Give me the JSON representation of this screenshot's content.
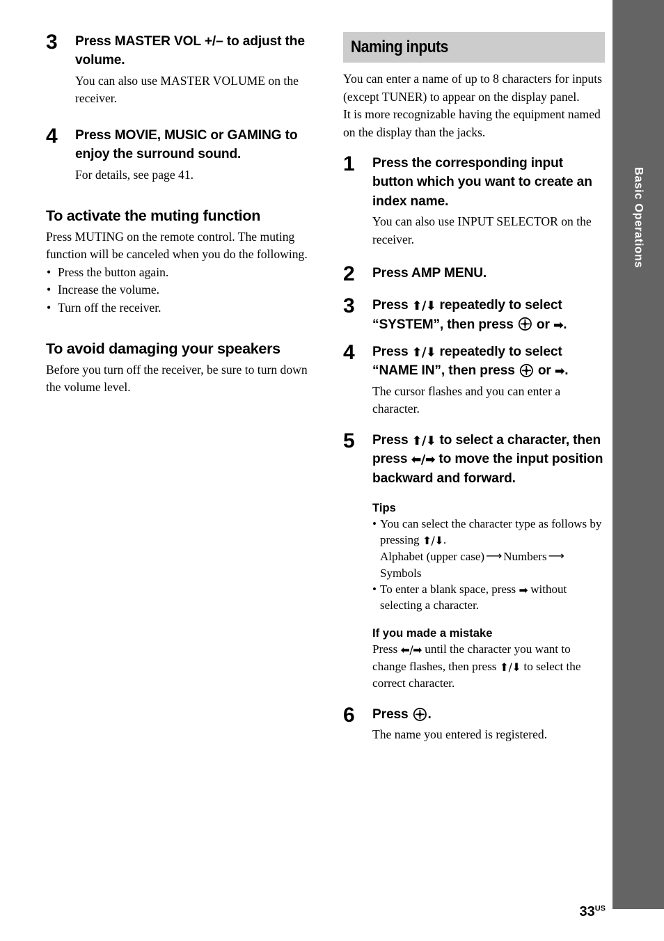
{
  "page": {
    "folio_number": "33",
    "folio_suffix": "US",
    "side_tab_label": "Basic Operations",
    "side_tab_color": "#646464",
    "banner_color": "#cccccc"
  },
  "glyphs": {
    "arrow_up": "⬆",
    "arrow_down": "⬇",
    "arrow_left": "⬅",
    "arrow_right": "➡",
    "arrow_updown": "⬆/⬇",
    "arrow_leftright": "⬅/➡",
    "long_arrow_right": "⟶",
    "enter_button": "enter-button-icon",
    "bullet": "•"
  },
  "left_column": {
    "steps": [
      {
        "number": "3",
        "title": "Press MASTER VOL +/– to adjust the volume.",
        "description": "You can also use MASTER VOLUME on the receiver."
      },
      {
        "number": "4",
        "title": "Press MOVIE, MUSIC or GAMING to enjoy the surround sound.",
        "description": "For details, see page 41."
      }
    ],
    "sections": [
      {
        "heading": "To activate the muting function",
        "paragraph": "Press MUTING on the remote control. The muting function will be canceled when you do the following.",
        "bullets": [
          "Press the button again.",
          "Increase the volume.",
          "Turn off the receiver."
        ]
      },
      {
        "heading": "To avoid damaging your speakers",
        "paragraph": "Before you turn off the receiver, be sure to turn down the volume level.",
        "bullets": []
      }
    ]
  },
  "right_column": {
    "banner_title": "Naming inputs",
    "intro_paragraph_1": "You can enter a name of up to 8 characters for inputs (except TUNER) to appear on the display panel.",
    "intro_paragraph_2": "It is more recognizable having the equipment named on the display than the jacks.",
    "steps": [
      {
        "number": "1",
        "title": "Press the corresponding input button which you want to create an index name.",
        "description": "You can also use INPUT SELECTOR on the receiver."
      },
      {
        "number": "2",
        "title": "Press AMP MENU.",
        "description": ""
      },
      {
        "number": "3",
        "title_part_1": "Press ",
        "title_part_2": " repeatedly to select “SYSTEM”, then press ",
        "title_part_3": " or ",
        "title_part_4": ".",
        "description": ""
      },
      {
        "number": "4",
        "title_part_1": "Press ",
        "title_part_2": " repeatedly to select “NAME IN”, then press ",
        "title_part_3": " or ",
        "title_part_4": ".",
        "description": "The cursor flashes and you can enter a character."
      },
      {
        "number": "5",
        "title_part_1": "Press ",
        "title_part_2": " to select a character, then press ",
        "title_part_3": " to move the input position backward and forward.",
        "description": ""
      },
      {
        "number": "6",
        "title_part_1": "Press ",
        "title_part_2": ".",
        "description": "The name you entered is registered."
      }
    ],
    "tips": {
      "heading": "Tips",
      "bullet_1_part_1": "You can select the character type as follows by pressing ",
      "bullet_1_part_2": ".",
      "bullet_1_sequence_1": "Alphabet (upper case)",
      "bullet_1_sequence_2": "Numbers",
      "bullet_1_sequence_3": "Symbols",
      "bullet_2_part_1": "To enter a blank space, press ",
      "bullet_2_part_2": " without selecting a character."
    },
    "mistake": {
      "heading": "If you made a mistake",
      "text_part_1": "Press ",
      "text_part_2": " until the character you want to change flashes, then press ",
      "text_part_3": " to select the correct character."
    }
  }
}
